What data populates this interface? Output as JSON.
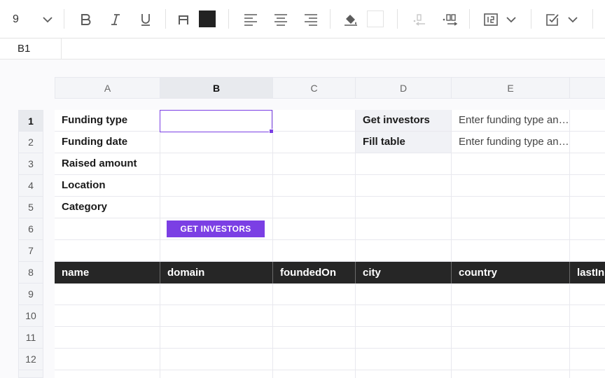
{
  "toolbar": {
    "font_size": "9",
    "text_color": "#222222",
    "fill_color": "#ffffff"
  },
  "formula_bar": {
    "cell_ref": "B1",
    "value": ""
  },
  "columns": [
    "A",
    "B",
    "C",
    "D",
    "E"
  ],
  "active_column": "B",
  "rows": [
    "1",
    "2",
    "3",
    "4",
    "5",
    "6",
    "7",
    "8",
    "9",
    "10",
    "11",
    "12"
  ],
  "active_row": "1",
  "cells": {
    "A1": "Funding type",
    "A2": "Funding date",
    "A3": "Raised amount",
    "A4": "Location",
    "A5": "Category",
    "D1": "Get investors",
    "D2": "Fill table",
    "E1": "Enter funding type and date, raised amount, location and category",
    "E2": "Enter funding type and date, raised amount, location and category"
  },
  "button": {
    "label": "GET INVESTORS",
    "color": "#7b3fe4"
  },
  "table_headers": [
    "name",
    "domain",
    "foundedOn",
    "city",
    "country",
    "lastIn"
  ]
}
